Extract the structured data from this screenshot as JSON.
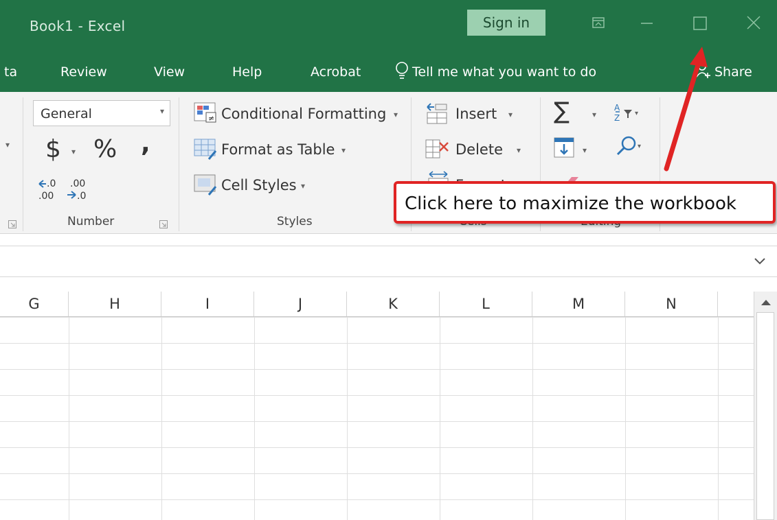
{
  "window": {
    "title": "Book1  -  Excel",
    "sign_in": "Sign in",
    "icons": [
      "ribbon-display-options-icon",
      "minimize-icon",
      "maximize-icon",
      "close-icon"
    ],
    "accent": "#217346"
  },
  "tabs": {
    "items": [
      "ta",
      "Review",
      "View",
      "Help",
      "Acrobat"
    ],
    "tell_me": "Tell me what you want to do",
    "share": "Share"
  },
  "ribbon": {
    "number": {
      "format_value": "General",
      "currency_symbol": "$",
      "percent_symbol": "%",
      "comma_symbol": "͹",
      "increase_decimal_top": ".0",
      "increase_decimal_bottom": ".00",
      "decrease_decimal_top": ".00",
      "decrease_decimal_bottom": ".0",
      "group_label": "Number"
    },
    "styles": {
      "conditional_formatting": "Conditional Formatting",
      "format_as_table": "Format as Table",
      "cell_styles": "Cell Styles",
      "group_label": "Styles"
    },
    "cells": {
      "insert": "Insert",
      "delete": "Delete",
      "format": "Format",
      "group_label": "Cells"
    },
    "editing": {
      "autosum_symbol": "∑",
      "group_label": "Editing"
    }
  },
  "grid": {
    "columns": [
      "G",
      "H",
      "I",
      "J",
      "K",
      "L",
      "M",
      "N"
    ]
  },
  "annotation": {
    "text": "Click here to maximize the workbook",
    "color": "#e02424"
  }
}
